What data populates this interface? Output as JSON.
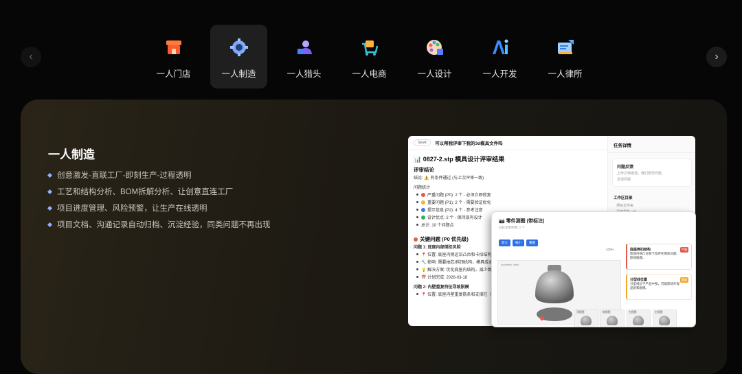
{
  "nav": {
    "prev_icon": "chevron-left-icon",
    "next_icon": "chevron-right-icon",
    "tabs": [
      {
        "label": "一人门店",
        "icon": "storefront-icon",
        "active": false
      },
      {
        "label": "一人制造",
        "icon": "gear-icon",
        "active": true
      },
      {
        "label": "一人猎头",
        "icon": "headhunter-icon",
        "active": false
      },
      {
        "label": "一人电商",
        "icon": "shopping-cart-icon",
        "active": false
      },
      {
        "label": "一人设计",
        "icon": "palette-icon",
        "active": false
      },
      {
        "label": "一人开发",
        "icon": "ai-icon",
        "active": false
      },
      {
        "label": "一人律所",
        "icon": "law-document-icon",
        "active": false
      }
    ]
  },
  "panel": {
    "title": "一人制造",
    "features": [
      "创意激发-直联工厂-即刻生产-过程透明",
      "工艺和结构分析、BOM拆解分析、让创意直连工厂",
      "项目进度管理、风险预警，让生产在线透明",
      "项目文档、沟通记录自动归档、沉淀经验，同类问题不再出现"
    ]
  },
  "screenshot1": {
    "badge": "Spark",
    "question": "可以帮我评审下我的3d模具文件吗",
    "heading": "0827-2.stp 模具设计评审结果",
    "section_review": "评审结论",
    "conclusion": "结论: ⚠️ 有条件通过 (与上次评审一致)",
    "stats_title": "问题统计",
    "stats": [
      {
        "text": "严重问题 (P0): 2 个 - 必须立即修复",
        "color": "#e25b4b"
      },
      {
        "text": "重要问题 (P1): 2 个 - 需要验证优化",
        "color": "#f2b632"
      },
      {
        "text": "提示信息 (P2): 4 个 - 参考注意",
        "color": "#3a7be0"
      },
      {
        "text": "设计优点: 2 个 - 保持现有设计",
        "color": "#2fb35a"
      },
      {
        "text": "总计: 10 个问题点",
        "color": ""
      }
    ],
    "key_issues": "关键问题 (P0 优先级)",
    "issue1_title": "问题 1: 底座内部倒扣风险",
    "issue1_rows": [
      "位置: 底座内侧边沿凸台和卡扣结构",
      "影响: 需要抽芯/斜顶机构，模具成本增加",
      "解决方案: 优化底座内结构，减少倒扣",
      "计划完成: 2026-03-18"
    ],
    "issue2_title": "问题 2: 内壁重复特征导致脱模",
    "issue2_row": "位置: 底座内壁重复筋条和支撑柱（有",
    "side_title": "任务详情",
    "side_card_title": "问题反馈",
    "side_card_sub": "上传文档或话，我们帮您问题",
    "side_card_sub2": "反馈问题",
    "side_section": "工作区目录",
    "side_tree": [
      "项目文件夹",
      "评审报告.pdf"
    ]
  },
  "screenshot2": {
    "title": "零件测图 (带标注)",
    "subtitle": "已标注零件数: 2 个",
    "tools": [
      "放大",
      "缩小",
      "重置"
    ],
    "zoom": "100%",
    "view_label": "Isometric View",
    "card1_title": "底座倒扣结构",
    "card1_tag": "严重",
    "card1_text": "底座内侧凸台和卡扣存在倒扣问题，影响脱模。",
    "card2_title": "分型线位置",
    "card2_tag": "重要",
    "card2_text": "分型线位于产品中部，可能影响外观品质和脱模。",
    "thumbs": [
      "顶视图",
      "前视图",
      "左视图",
      "右视图"
    ]
  }
}
